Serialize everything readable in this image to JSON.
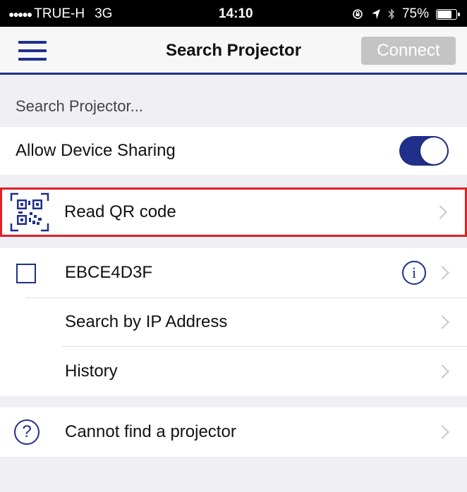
{
  "status_bar": {
    "signal": "●●●●●",
    "carrier": "TRUE-H",
    "network": "3G",
    "time": "14:10",
    "battery_percent": "75%",
    "battery_level": 0.75,
    "icons": [
      "rotation-lock-icon",
      "location-icon",
      "bluetooth-icon",
      "battery-icon"
    ]
  },
  "nav": {
    "menu_icon": "hamburger-menu-icon",
    "title": "Search Projector",
    "connect_label": "Connect",
    "connect_enabled": false
  },
  "section_header": "Search Projector...",
  "sharing": {
    "label": "Allow Device Sharing",
    "enabled": true
  },
  "qr": {
    "label": "Read QR code",
    "icon": "qr-code-icon"
  },
  "devices": [
    {
      "name": "EBCE4D3F",
      "checked": false,
      "info_icon": "info-icon",
      "info_glyph": "i"
    }
  ],
  "ip_search": {
    "label": "Search by IP Address"
  },
  "history": {
    "label": "History"
  },
  "help": {
    "label": "Cannot find a projector",
    "icon": "help-icon",
    "glyph": "?"
  },
  "colors": {
    "accent": "#1f2f8a",
    "highlight": "#e01f26",
    "disabled_button": "#c4c4c4",
    "background": "#efeff4"
  }
}
